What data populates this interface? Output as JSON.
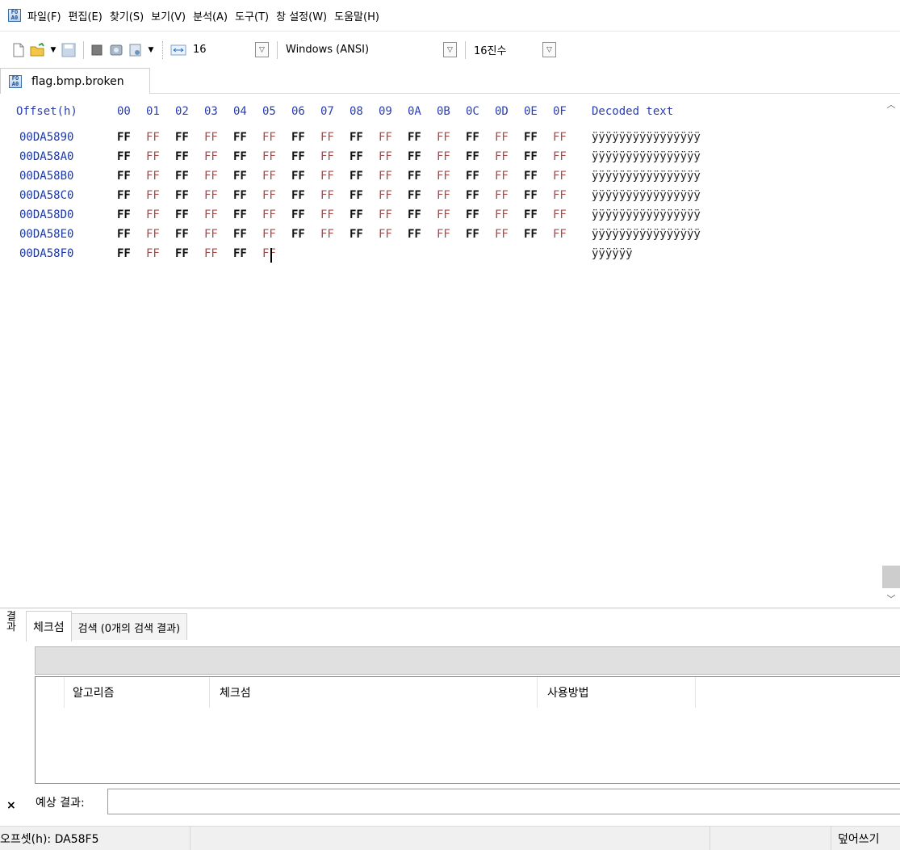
{
  "menu": [
    "파일(F)",
    "편집(E)",
    "찾기(S)",
    "보기(V)",
    "분석(A)",
    "도구(T)",
    "창 설정(W)",
    "도움말(H)"
  ],
  "toolbar": {
    "bytes_per_row": "16",
    "encoding": "Windows (ANSI)",
    "number_base": "16진수"
  },
  "document_tab": "flag.bmp.broken",
  "hex": {
    "header_offset": "Offset(h)",
    "columns": [
      "00",
      "01",
      "02",
      "03",
      "04",
      "05",
      "06",
      "07",
      "08",
      "09",
      "0A",
      "0B",
      "0C",
      "0D",
      "0E",
      "0F"
    ],
    "header_decoded": "Decoded text",
    "rows": [
      {
        "offset": "00DA5890",
        "bytes": [
          "FF",
          "FF",
          "FF",
          "FF",
          "FF",
          "FF",
          "FF",
          "FF",
          "FF",
          "FF",
          "FF",
          "FF",
          "FF",
          "FF",
          "FF",
          "FF"
        ],
        "decoded": "ÿÿÿÿÿÿÿÿÿÿÿÿÿÿÿÿ"
      },
      {
        "offset": "00DA58A0",
        "bytes": [
          "FF",
          "FF",
          "FF",
          "FF",
          "FF",
          "FF",
          "FF",
          "FF",
          "FF",
          "FF",
          "FF",
          "FF",
          "FF",
          "FF",
          "FF",
          "FF"
        ],
        "decoded": "ÿÿÿÿÿÿÿÿÿÿÿÿÿÿÿÿ"
      },
      {
        "offset": "00DA58B0",
        "bytes": [
          "FF",
          "FF",
          "FF",
          "FF",
          "FF",
          "FF",
          "FF",
          "FF",
          "FF",
          "FF",
          "FF",
          "FF",
          "FF",
          "FF",
          "FF",
          "FF"
        ],
        "decoded": "ÿÿÿÿÿÿÿÿÿÿÿÿÿÿÿÿ"
      },
      {
        "offset": "00DA58C0",
        "bytes": [
          "FF",
          "FF",
          "FF",
          "FF",
          "FF",
          "FF",
          "FF",
          "FF",
          "FF",
          "FF",
          "FF",
          "FF",
          "FF",
          "FF",
          "FF",
          "FF"
        ],
        "decoded": "ÿÿÿÿÿÿÿÿÿÿÿÿÿÿÿÿ"
      },
      {
        "offset": "00DA58D0",
        "bytes": [
          "FF",
          "FF",
          "FF",
          "FF",
          "FF",
          "FF",
          "FF",
          "FF",
          "FF",
          "FF",
          "FF",
          "FF",
          "FF",
          "FF",
          "FF",
          "FF"
        ],
        "decoded": "ÿÿÿÿÿÿÿÿÿÿÿÿÿÿÿÿ"
      },
      {
        "offset": "00DA58E0",
        "bytes": [
          "FF",
          "FF",
          "FF",
          "FF",
          "FF",
          "FF",
          "FF",
          "FF",
          "FF",
          "FF",
          "FF",
          "FF",
          "FF",
          "FF",
          "FF",
          "FF"
        ],
        "decoded": "ÿÿÿÿÿÿÿÿÿÿÿÿÿÿÿÿ"
      },
      {
        "offset": "00DA58F0",
        "bytes": [
          "FF",
          "FF",
          "FF",
          "FF",
          "FF",
          "FF"
        ],
        "decoded": "ÿÿÿÿÿÿ"
      }
    ]
  },
  "results": {
    "side_title": "결과",
    "tabs": [
      "체크섬",
      "검색 (0개의 검색 결과)"
    ],
    "columns": [
      "알고리즘",
      "체크섬",
      "사용방법"
    ],
    "expected_label": "예상 결과:",
    "expected_value": ""
  },
  "status": {
    "offset": "오프셋(h): DA58F5",
    "mode": "덮어쓰기"
  }
}
